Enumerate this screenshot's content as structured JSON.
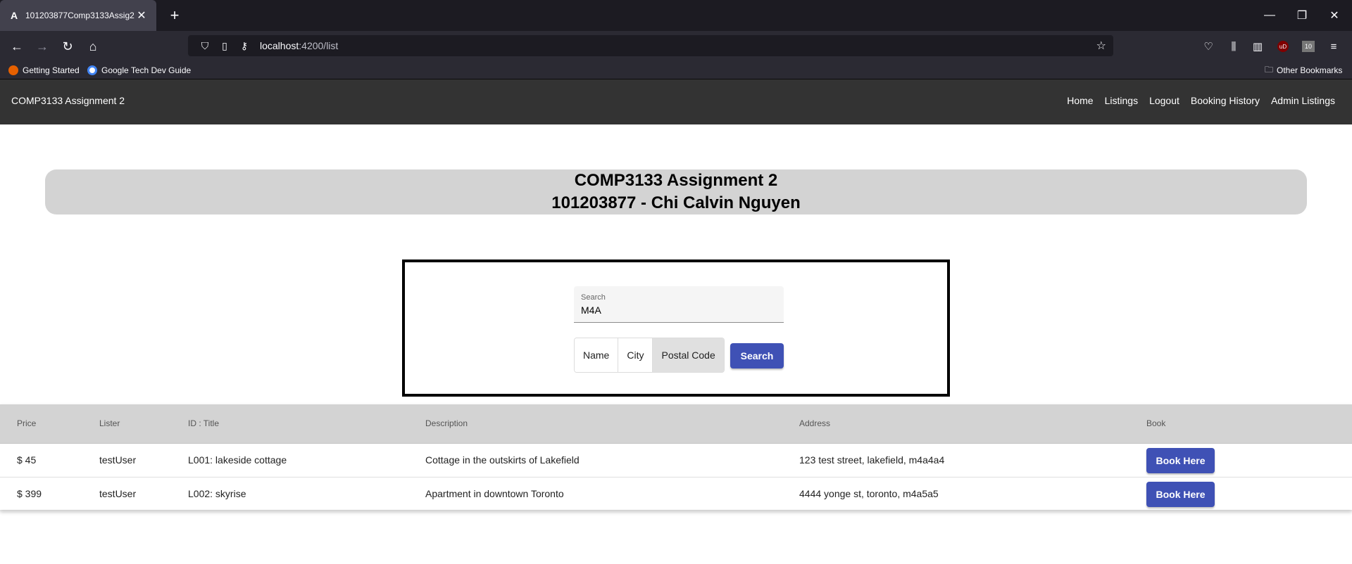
{
  "browser": {
    "tab_title": "101203877Comp3133Assig2",
    "url_host": "localhost",
    "url_path": ":4200/list",
    "bookmarks": [
      {
        "label": "Getting Started"
      },
      {
        "label": "Google Tech Dev Guide"
      }
    ],
    "other_bookmarks": "Other Bookmarks",
    "ublock_label": "uD",
    "badge_label": "10"
  },
  "nav": {
    "brand": "COMP3133 Assignment 2",
    "links": [
      "Home",
      "Listings",
      "Logout",
      "Booking History",
      "Admin Listings"
    ]
  },
  "banner": {
    "line1": "COMP3133 Assignment 2",
    "line2": "101203877 - Chi Calvin Nguyen"
  },
  "search": {
    "label": "Search",
    "value": "M4A",
    "options": [
      "Name",
      "City",
      "Postal Code"
    ],
    "selected_option": "Postal Code",
    "button_label": "Search"
  },
  "table": {
    "headers": [
      "Price",
      "Lister",
      "ID : Title",
      "Description",
      "Address",
      "Book"
    ],
    "rows": [
      {
        "price": "$ 45",
        "lister": "testUser",
        "title": "L001: lakeside cottage",
        "description": "Cottage in the outskirts of Lakefield",
        "address": "123 test street, lakefield, m4a4a4",
        "book": "Book Here"
      },
      {
        "price": "$ 399",
        "lister": "testUser",
        "title": "L002: skyrise",
        "description": "Apartment in downtown Toronto",
        "address": "4444 yonge st, toronto, m4a5a5",
        "book": "Book Here"
      }
    ]
  },
  "colors": {
    "primary": "#3f51b5",
    "navbar": "#333333",
    "banner": "#d3d3d3"
  }
}
